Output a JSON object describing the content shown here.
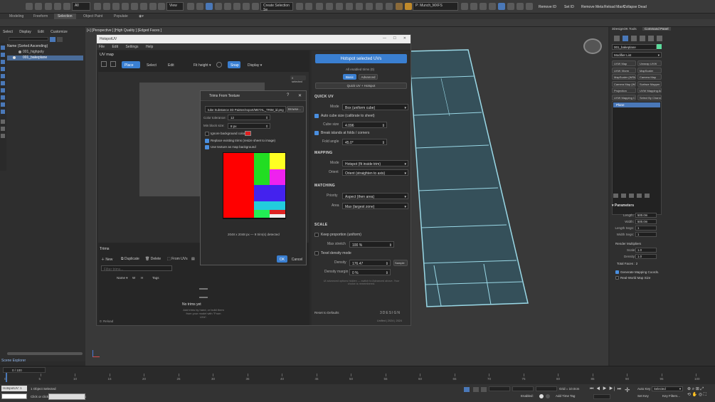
{
  "toolbar": {
    "view_dropdown": "View",
    "all_dropdown": "All",
    "selection_set": "Create Selection Se",
    "workspace": "P: Munch_MXFS",
    "right_buttons": [
      "Remove ID",
      "Set ID",
      "Remove Meta",
      "Reload MaxV",
      "Collapse Dead"
    ]
  },
  "ribbon_tabs": [
    "Modeling",
    "Freeform",
    "Selection",
    "Object Paint",
    "Populate"
  ],
  "scene_explorer": {
    "menu": [
      "Select",
      "Display",
      "Edit",
      "Customize"
    ],
    "header": "Name (Sorted Ascending)",
    "items": [
      "001_highpoly",
      "001_bakeplane"
    ],
    "footer": "Scene Explorer"
  },
  "viewport_label": "[+] [Perspective ] [High Quality ] [Edged Faces ]",
  "hotspot_window": {
    "title": "HotspotUV",
    "menu": [
      "File",
      "Edit",
      "Settings",
      "Help"
    ],
    "uv_map_title": "UV map",
    "tools": [
      "Place",
      "Select",
      "Edit"
    ],
    "fit_mode": "Fit height",
    "snap": "Snap",
    "display": "Display",
    "selected_badge": "0 selected",
    "trims": {
      "title": "Trims",
      "actions": [
        "New",
        "Duplicate",
        "Delete",
        "From UVs"
      ],
      "filter_placeholder": "Filter trims...",
      "columns": [
        "Name",
        "W",
        "H",
        "Tags"
      ],
      "empty_title": "No trims yet",
      "empty_desc": "Add trims by hand, or build them from your model with \"From UVs\"."
    },
    "status": "0: Reload",
    "version": "Unified | 2024 | 2024",
    "right": {
      "main_button": "Hotspot selected UVs",
      "enabled_info": "All enabled trims (0)",
      "modes": [
        "Basic",
        "Advanced"
      ],
      "quick_uv": "Quick UV + Hotspot",
      "quick_uv_section": {
        "title": "QUICK UV",
        "mode_label": "Mode",
        "mode_value": "Box (uniform cube)",
        "auto_cube": "Auto cube size (calibrate to sheet)",
        "cube_size_label": "Cube size",
        "cube_size": "4.096",
        "break_islands": "Break islands at folds / corners",
        "fold_angle_label": "Fold angle",
        "fold_angle": "45.0°"
      },
      "mapping": {
        "title": "MAPPING",
        "mode_label": "Mode",
        "mode_value": "Hotspot (fit inside trim)",
        "orient_label": "Orient",
        "orient_value": "Orient (straighten to axis)"
      },
      "matching": {
        "title": "MATCHING",
        "priority_label": "Priority",
        "priority_value": "Aspect (then area)",
        "area_label": "Area",
        "area_value": "Max (largest zone)"
      },
      "scale": {
        "title": "SCALE",
        "keep_prop": "Keep proportion (uniform)",
        "max_stretch_label": "Max stretch",
        "max_stretch": "100 %",
        "texel": "Texel density mode",
        "density_label": "Density",
        "density": "176.47",
        "density_btn": "Sample",
        "margin_label": "Density margin",
        "margin": "0 %",
        "note": "UI advanced options hidden — switch to Advanced above. Your choice is remembered."
      },
      "reset": "Reset to Defaults",
      "brand": "3DESIGN"
    }
  },
  "dialog": {
    "title": "Trims From Texture",
    "path": "tube Substance 3D Painter/export/METAL_TRIM_id.png",
    "browse": "Browse...",
    "color_tolerance_label": "Color tolerance:",
    "color_tolerance": "12",
    "min_block_label": "Min block size:",
    "min_block": "8 px",
    "ignore_bg": "Ignore background color",
    "replace_existing": "Replace existing trims (resize sheet to image)",
    "use_texture": "Use texture as map background",
    "info": "2048 x 2048 px  —  9 trim(s) detected",
    "ok": "OK",
    "cancel": "Cancel"
  },
  "command_panel": {
    "tabs": [
      "3DesignOK Tools",
      "Command Panel"
    ],
    "object_name": "001_bakeplane",
    "modifier_list": "Modifier List",
    "modifier_buttons": [
      "UVW Map",
      "Unwrap UVW",
      "UVW Xform",
      "MapScaler",
      "MapScaler (WSM)",
      "Camera Map",
      "Camera Map (WSM)",
      "Surface Mapper",
      "Projection",
      "UVW Mapping Add",
      "UVW Mapping Clear",
      "Select By Channel"
    ],
    "stack_item": "Plane",
    "parameters_title": "Parameters",
    "params": [
      {
        "label": "Length:",
        "value": "500.0m"
      },
      {
        "label": "Width:",
        "value": "500.0m"
      },
      {
        "label": "Length Segs:",
        "value": "1"
      },
      {
        "label": "Width Segs:",
        "value": "1"
      }
    ],
    "render_mult": "Render Multipliers",
    "scale_label": "Scale:",
    "scale_value": "1.0",
    "density_label": "Density:",
    "density_value": "1.0",
    "total_faces": "Total Faces : 2",
    "gen_coords": "Generate Mapping Coords.",
    "real_world": "Real-World Map Size"
  },
  "timeline": {
    "frame": "0 / 100",
    "ticks": [
      "0",
      "5",
      "10",
      "15",
      "20",
      "25",
      "30",
      "35",
      "40",
      "45",
      "50",
      "55",
      "60",
      "65",
      "70",
      "75",
      "80",
      "85",
      "90",
      "95",
      "100"
    ]
  },
  "status": {
    "script_label": "HotspotUV: 1",
    "selection": "1 Object Selected",
    "hint": "Click or click-and-drag to select objects",
    "grid": "Grid = 10.0cm",
    "enabled": "Enabled:",
    "add_time_tag": "Add Time Tag",
    "auto_key": "Auto Key",
    "set_key": "Set Key",
    "selected": "Selected",
    "key_filters": "Key Filters..."
  },
  "colors": {
    "accent": "#3a7fd1",
    "plane": "#35505a",
    "plane_border": "#9ad8e6"
  }
}
